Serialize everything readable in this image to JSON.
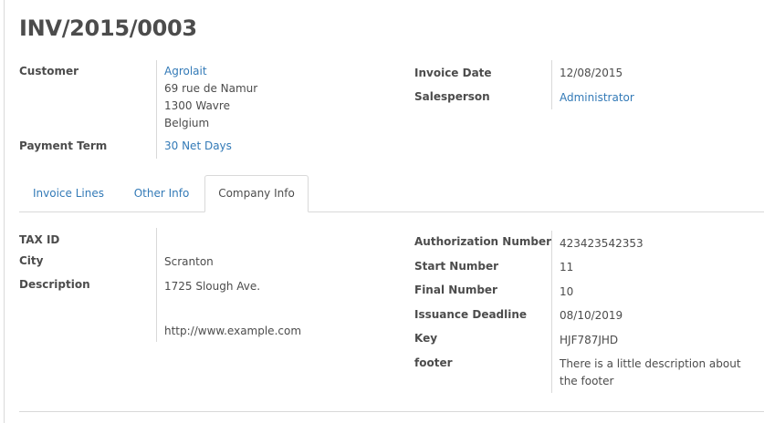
{
  "invoice": {
    "title": "INV/2015/0003"
  },
  "header": {
    "customer_label": "Customer",
    "customer_name": "Agrolait",
    "address_line1": "69 rue de Namur",
    "address_line2": "1300 Wavre",
    "address_line3": "Belgium",
    "payment_term_label": "Payment Term",
    "payment_term_value": "30 Net Days",
    "invoice_date_label": "Invoice Date",
    "invoice_date_value": "12/08/2015",
    "salesperson_label": "Salesperson",
    "salesperson_value": "Administrator"
  },
  "tabs": [
    {
      "label": "Invoice Lines"
    },
    {
      "label": "Other Info"
    },
    {
      "label": "Company Info",
      "active": true
    }
  ],
  "company_info": {
    "tax_id_label": "TAX ID",
    "tax_id_value": "",
    "city_label": "City",
    "city_value": "Scranton",
    "description_label": "Description",
    "description_line1": "1725 Slough Ave.",
    "description_line2": "http://www.example.com",
    "auth_number_label": "Authorization Number",
    "auth_number_value": "423423542353",
    "start_number_label": "Start Number",
    "start_number_value": "11",
    "final_number_label": "Final Number",
    "final_number_value": "10",
    "issuance_deadline_label": "Issuance Deadline",
    "issuance_deadline_value": "08/10/2019",
    "key_label": "Key",
    "key_value": "HJF787JHD",
    "footer_label": "footer",
    "footer_value": "There is a little description about the footer"
  }
}
